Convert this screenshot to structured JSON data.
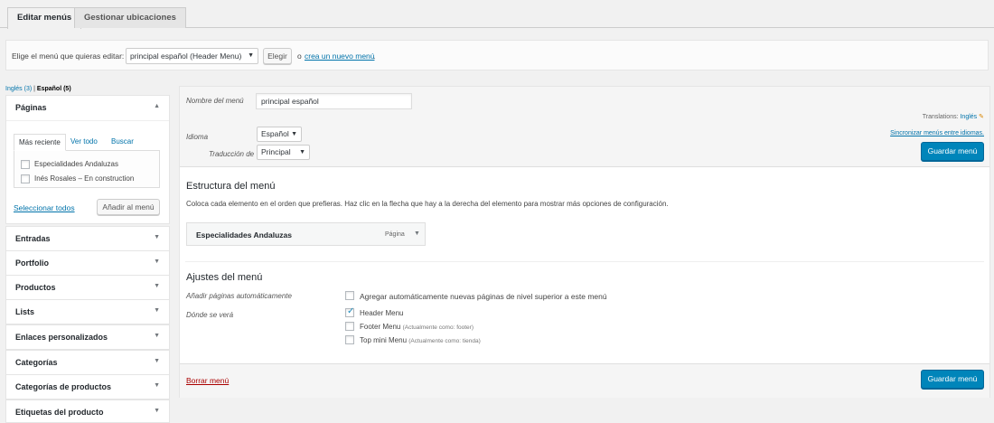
{
  "tabs": [
    {
      "label": "Editar menús",
      "active": true
    },
    {
      "label": "Gestionar ubicaciones",
      "active": false
    }
  ],
  "manage": {
    "label": "Elige el menú que quieras editar:",
    "selected_menu": "principal español (Header Menu)",
    "select_button": "Elegir",
    "or_text": "o",
    "create_link": "crea un nuevo menú",
    "period": "."
  },
  "languages": {
    "inactive": "Inglés (3)",
    "separator": "|",
    "active": "Español (5)"
  },
  "left": {
    "pages_section": {
      "title": "Páginas",
      "tabs": [
        "Más reciente",
        "Ver todo",
        "Buscar"
      ],
      "items": [
        {
          "label": "Especialidades Andaluzas",
          "checked": false
        },
        {
          "label": "Inés Rosales – En construction",
          "checked": false
        }
      ],
      "select_all": "Seleccionar todos",
      "add_button": "Añadir al menú"
    },
    "sections": [
      "Entradas",
      "Portfolio",
      "Productos",
      "Lists",
      "Enlaces personalizados",
      "Categorías",
      "Categorías de productos",
      "Etiquetas del producto"
    ]
  },
  "main": {
    "name_label": "Nombre del menú",
    "name_value": "principal español",
    "translations_label": "Translations:",
    "translations_link": "Inglés",
    "language_label": "Idioma",
    "language_value": "Español",
    "sync_link": "Sincronizar menús entre idiomas.",
    "translation_of_label": "Traducción de",
    "translation_of_value": "Principal",
    "save_button": "Guardar menú",
    "structure_title": "Estructura del menú",
    "structure_help": "Coloca cada elemento en el orden que prefieras. Haz clic en la flecha que hay a la derecha del elemento para mostrar más opciones de configuración.",
    "menu_item": {
      "title": "Especialidades Andaluzas",
      "type": "Página"
    },
    "settings_title": "Ajustes del menú",
    "auto_add_label": "Añadir páginas automáticamente",
    "auto_add_text": "Agregar automáticamente nuevas páginas de nivel superior a este menú",
    "location_label": "Dónde se verá",
    "locations": [
      {
        "label": "Header Menu",
        "note": "",
        "checked": true
      },
      {
        "label": "Footer Menu",
        "note": "(Actualmente como: footer)",
        "checked": false
      },
      {
        "label": "Top mini Menu",
        "note": "(Actualmente como: tienda)",
        "checked": false
      }
    ],
    "delete_link": "Borrar menú"
  },
  "colors": {
    "primary": "#0085ba",
    "link": "#0073aa",
    "delete": "#a00"
  }
}
